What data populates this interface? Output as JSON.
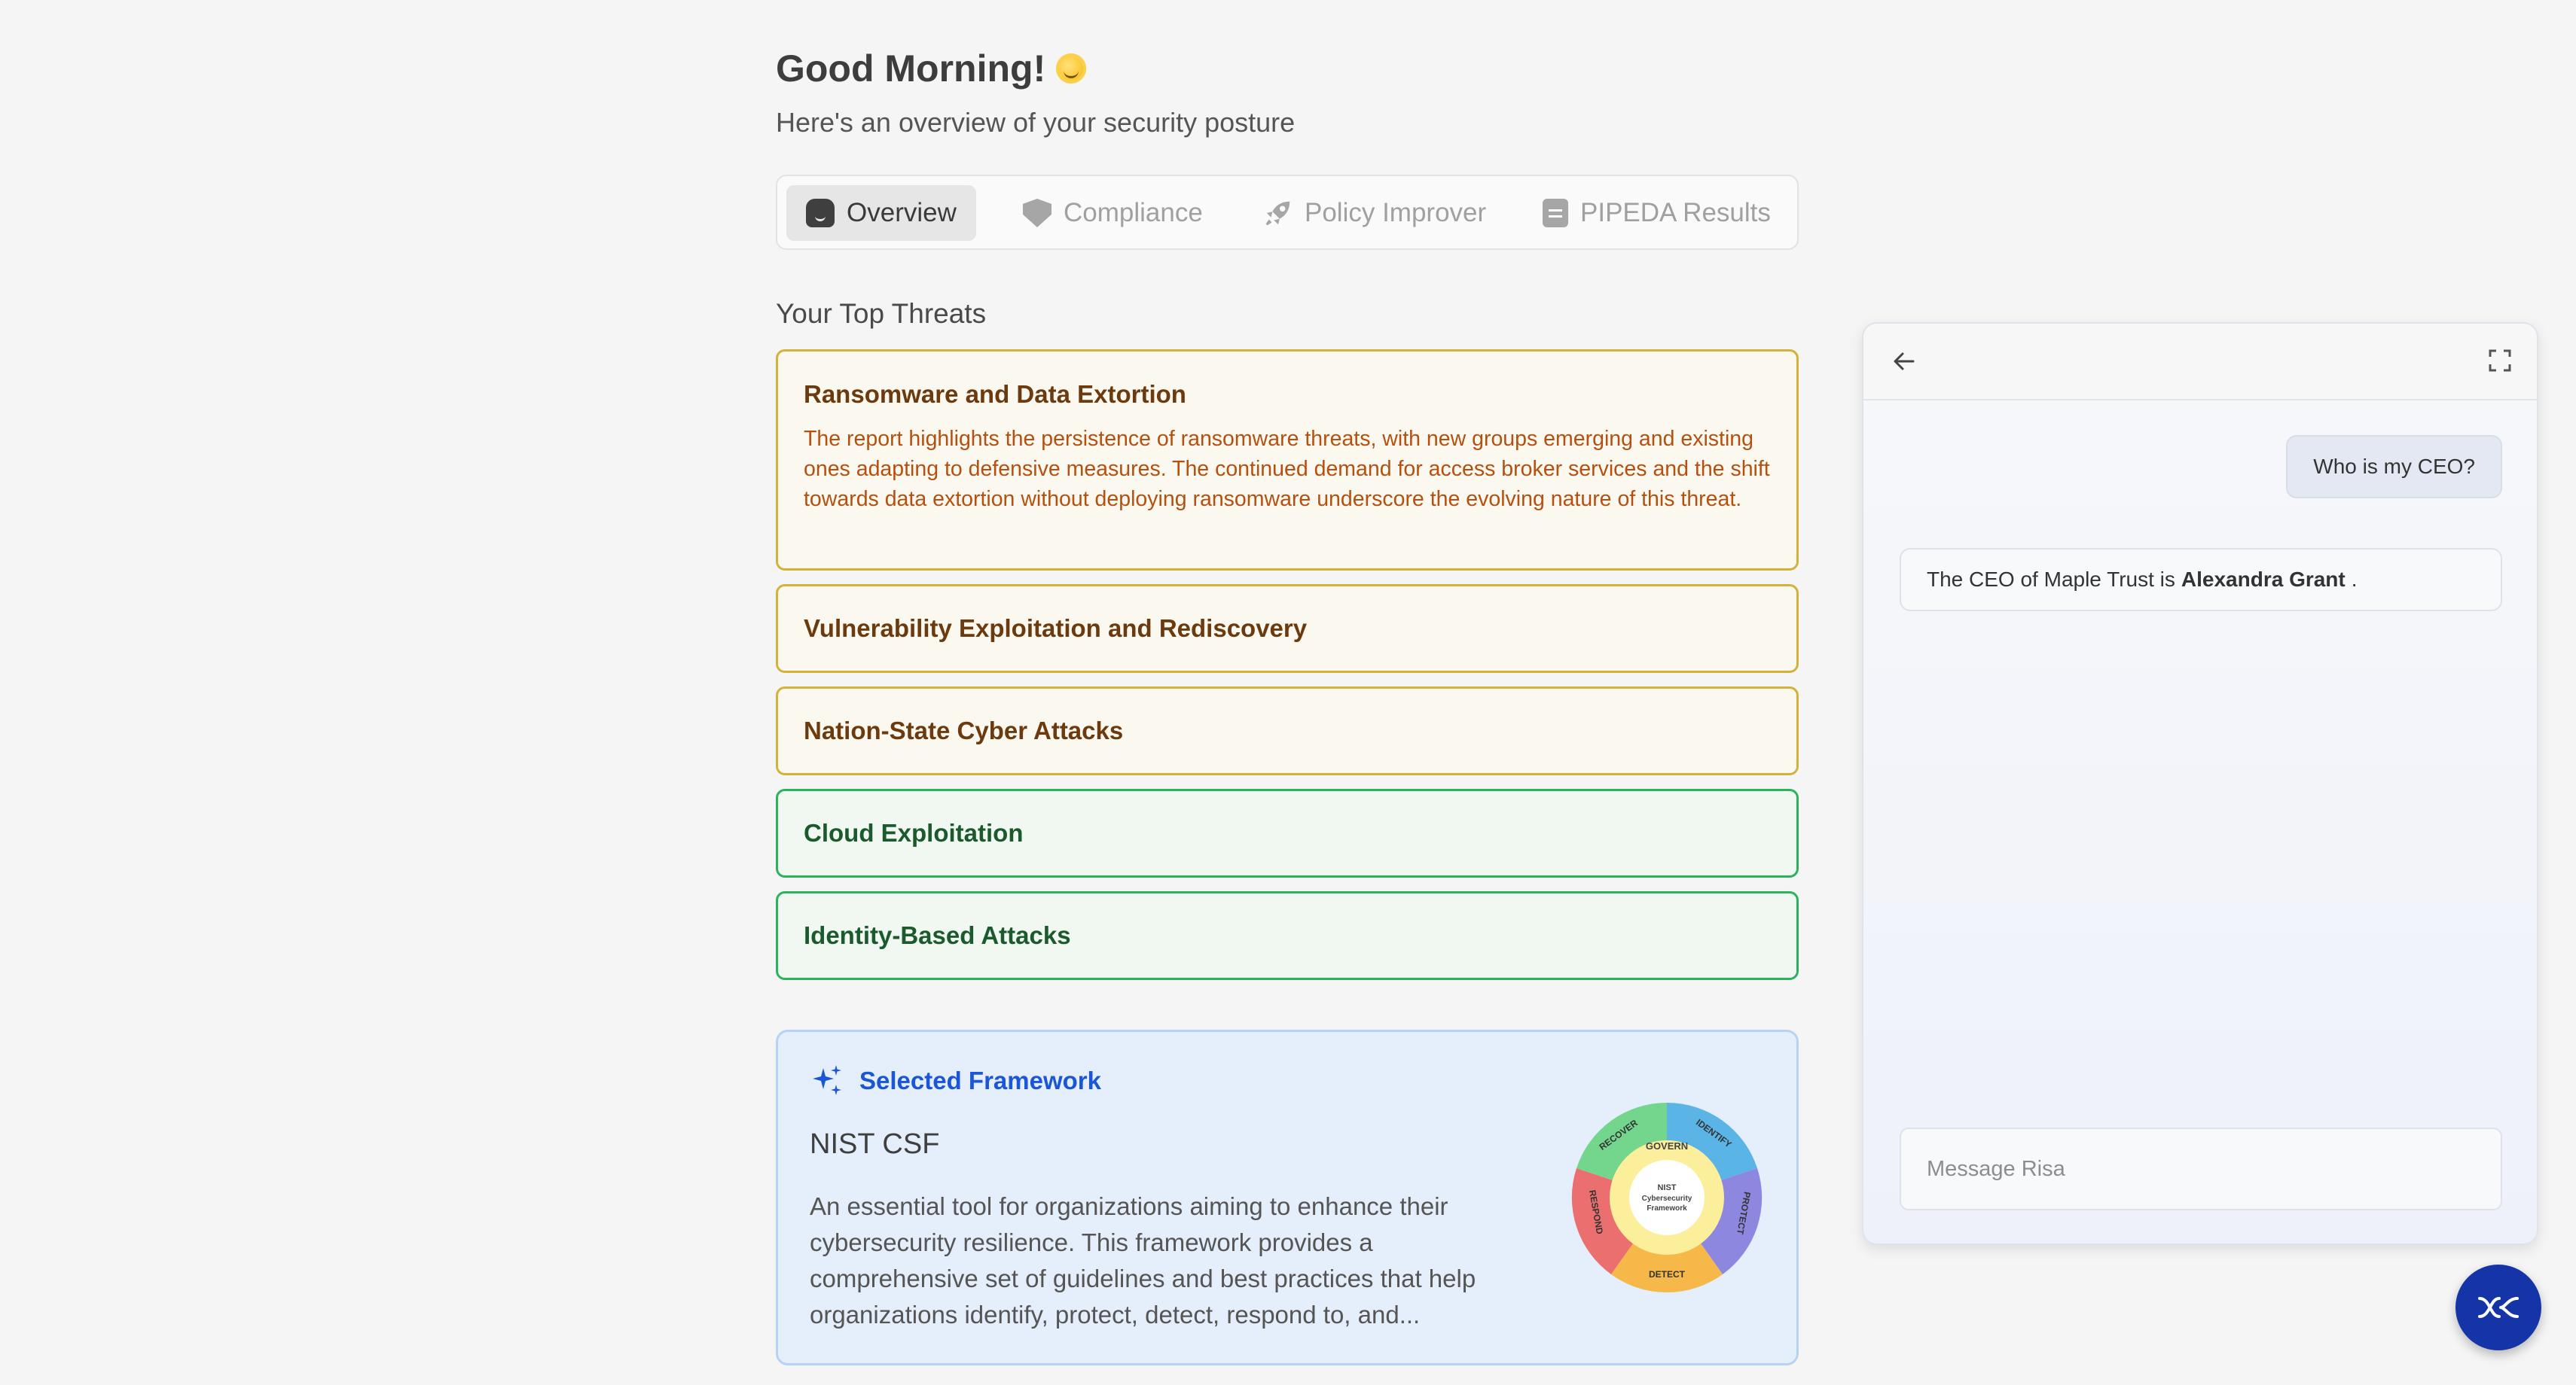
{
  "greeting": {
    "title": "Good Morning!",
    "emoji_icon": "sun-smile-icon",
    "subtitle": "Here's an overview of your security posture"
  },
  "tabs": [
    {
      "label": "Overview",
      "icon": "home-icon",
      "active": true
    },
    {
      "label": "Compliance",
      "icon": "shield-check-icon",
      "active": false
    },
    {
      "label": "Policy Improver",
      "icon": "rocket-icon",
      "active": false
    },
    {
      "label": "PIPEDA Results",
      "icon": "document-icon",
      "active": false
    }
  ],
  "threats": {
    "heading": "Your Top Threats",
    "items": [
      {
        "title": "Ransomware and Data Extortion",
        "severity_color": "#d4b13a",
        "description": "The report highlights the persistence of ransomware threats, with new groups emerging and existing ones adapting to defensive measures. The continued demand for access broker services and the shift towards data extortion without deploying ransomware underscore the evolving nature of this threat."
      },
      {
        "title": "Vulnerability Exploitation and Rediscovery",
        "severity_color": "#d4b13a"
      },
      {
        "title": "Nation-State Cyber Attacks",
        "severity_color": "#d4b13a"
      },
      {
        "title": "Cloud Exploitation",
        "severity_color": "#2bb35c"
      },
      {
        "title": "Identity-Based Attacks",
        "severity_color": "#2bb35c"
      }
    ]
  },
  "framework": {
    "badge": "Selected Framework",
    "name": "NIST CSF",
    "description": "An essential tool for organizations aiming to enhance their cybersecurity resilience. This framework provides a comprehensive set of guidelines and best practices that help organizations identify, protect, detect, respond to, and...",
    "wheel": {
      "center_line1": "NIST",
      "center_line2": "Cybersecurity",
      "center_line3": "Framework",
      "govern": "GOVERN",
      "segments": [
        "IDENTIFY",
        "PROTECT",
        "DETECT",
        "RESPOND",
        "RECOVER"
      ]
    }
  },
  "chat": {
    "user_message": "Who is my CEO?",
    "bot_prefix": "The CEO of Maple Trust is",
    "bot_name": "Alexandra Grant",
    "bot_suffix": ".",
    "input_placeholder": "Message Risa"
  },
  "colors": {
    "accent": "#1a56d6",
    "fab": "#1534a8",
    "amber": "#d4b13a",
    "green": "#2bb35c"
  }
}
